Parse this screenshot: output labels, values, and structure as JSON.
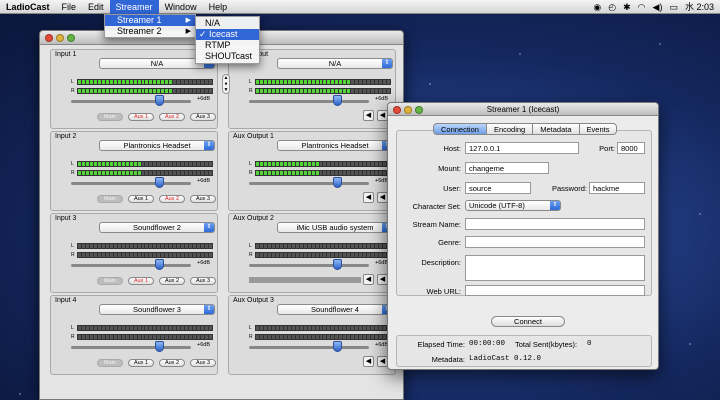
{
  "menubar": {
    "app": "LadioCast",
    "items": [
      "File",
      "Edit",
      "Streamer",
      "Window",
      "Help"
    ],
    "clock": "水 2:03"
  },
  "streamer_menu": {
    "items": [
      "Streamer 1",
      "Streamer 2"
    ],
    "submenu": [
      "N/A",
      "✓ Icecast",
      "RTMP",
      "SHOUTcast"
    ]
  },
  "main": {
    "panels": [
      {
        "title": "Input 1",
        "device": "N/A",
        "db": "+6dB",
        "buttons": [
          "Main",
          "Aux 1",
          "Aux 2",
          "Aux 3"
        ],
        "level": 24
      },
      {
        "title": "Aux Output",
        "device": "N/A",
        "db": "+6dB",
        "level": 24
      },
      {
        "title": "Input 2",
        "device": "Plantronics Headset",
        "db": "+6dB",
        "buttons": [
          "Main",
          "Aux 1",
          "Aux 2",
          "Aux 3"
        ],
        "level": 16
      },
      {
        "title": "Aux Output 1",
        "device": "Plantronics Headset",
        "db": "+6dB",
        "level": 16
      },
      {
        "title": "Input 3",
        "device": "Soundflower 2",
        "db": "+6dB",
        "buttons": [
          "Main",
          "Aux 1",
          "Aux 2",
          "Aux 3"
        ],
        "level": 0
      },
      {
        "title": "Aux Output 2",
        "device": "iMic USB audio system",
        "db": "+6dB",
        "level": 0
      },
      {
        "title": "Input 4",
        "device": "Soundflower 3",
        "db": "+6dB",
        "buttons": [
          "Main",
          "Aux 1",
          "Aux 2",
          "Aux 3"
        ],
        "level": 0
      },
      {
        "title": "Aux Output 3",
        "device": "Soundflower 4",
        "db": "+6dB",
        "level": 0
      }
    ],
    "channels": [
      "L",
      "R"
    ]
  },
  "streamer_window": {
    "title": "Streamer 1 (Icecast)",
    "tabs": [
      "Connection",
      "Encoding",
      "Metadata",
      "Events"
    ],
    "host_label": "Host:",
    "host": "127.0.0.1",
    "port_label": "Port:",
    "port": "8000",
    "mount_label": "Mount:",
    "mount": "changeme",
    "user_label": "User:",
    "user": "source",
    "password_label": "Password:",
    "password": "hackme",
    "charset_label": "Character Set:",
    "charset": "Unicode (UTF-8)",
    "stream_name_label": "Stream Name:",
    "genre_label": "Genre:",
    "description_label": "Description:",
    "web_url_label": "Web URL:",
    "connect": "Connect",
    "elapsed_label": "Elapsed Time:",
    "elapsed": "00:00:00",
    "total_label": "Total Sent(kbytes):",
    "total": "0",
    "metadata_label": "Metadata:",
    "metadata": "LadioCast 0.12.0"
  }
}
